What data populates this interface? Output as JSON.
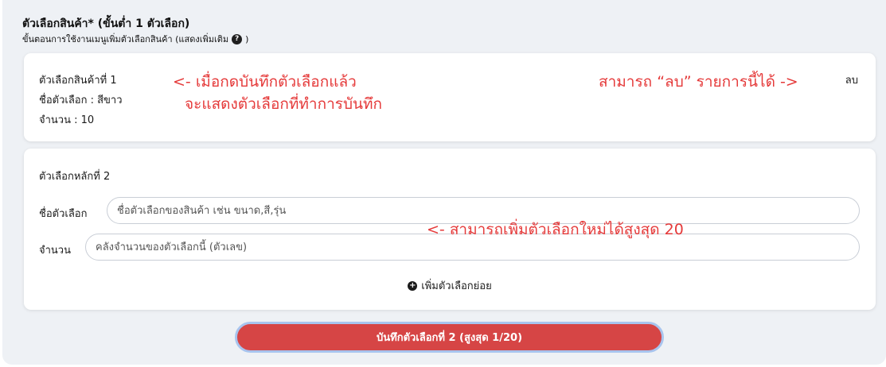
{
  "section": {
    "title": "ตัวเลือกสินค้า* (ขั้นต่ำ 1 ตัวเลือก)",
    "help_text": "ขั้นตอนการใช้งานเมนูเพิ่มตัวเลือกสินค้า (แสดงเพิ่มเติม",
    "help_suffix": ")",
    "help_icon": "question-circle-icon"
  },
  "saved_option": {
    "title": "ตัวเลือกสินค้าที่ 1",
    "name_line": "ชื่อตัวเลือก : สีขาว",
    "quantity_line": "จำนวน : 10",
    "delete_label": "ลบ"
  },
  "annotations": {
    "saved_line1": "<- เมื่อกดบันทึกตัวเลือกแล้ว",
    "saved_line2": "จะแสดงตัวเลือกที่ทำการบันทึก",
    "delete_hint": "สามารถ “ลบ” รายการนี้ได้ ->",
    "max_hint": "<- สามารถเพิ่มตัวเลือกใหม่ได้สูงสุด 20"
  },
  "new_option": {
    "title": "ตัวเลือกหลักที่ 2",
    "name_label": "ชื่อตัวเลือก",
    "name_placeholder": "ชื่อตัวเลือกของสินค้า เช่น ขนาด,สี,รุ่น",
    "name_value": "",
    "quantity_label": "จำนวน",
    "quantity_placeholder": "คลังจำนวนของตัวเลือกนี้ (ตัวเลข)",
    "quantity_value": "",
    "add_sub_label": "เพิ่มตัวเลือกย่อย",
    "add_sub_icon": "plus-circle-icon"
  },
  "save_button": {
    "label": "บันทึกตัวเลือกที่ 2 (สูงสุด 1/20)"
  },
  "colors": {
    "accent_red": "#d64545",
    "annotation_red": "#e53a3a",
    "panel_bg": "#eef1f5"
  }
}
